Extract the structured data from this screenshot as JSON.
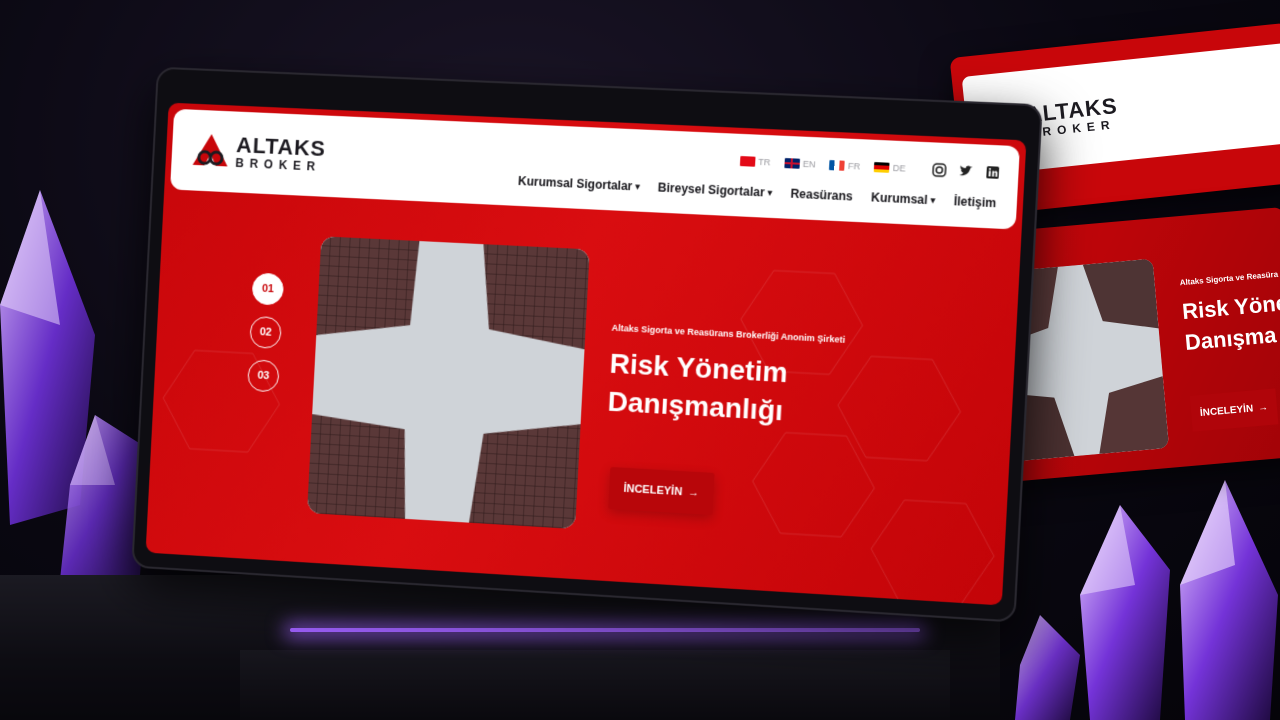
{
  "brand": {
    "name": "ALTAKS",
    "sub": "BROKER",
    "primary_color": "#c8060a",
    "accent_glow": "#a061ff"
  },
  "languages": [
    {
      "code": "TR",
      "flag": "turkey-flag-icon"
    },
    {
      "code": "EN",
      "flag": "uk-flag-icon"
    },
    {
      "code": "FR",
      "flag": "france-flag-icon"
    },
    {
      "code": "DE",
      "flag": "germany-flag-icon"
    }
  ],
  "socials": [
    "instagram-icon",
    "twitter-icon",
    "linkedin-icon"
  ],
  "nav": {
    "items": [
      {
        "label": "Kurumsal Sigortalar",
        "dropdown": true
      },
      {
        "label": "Bireysel Sigortalar",
        "dropdown": true
      },
      {
        "label": "Reasürans",
        "dropdown": false
      },
      {
        "label": "Kurumsal",
        "dropdown": true
      },
      {
        "label": "İletişim",
        "dropdown": false
      }
    ]
  },
  "slider": {
    "dots": [
      "01",
      "02",
      "03"
    ],
    "active": 0,
    "kicker": "Altaks Sigorta ve Reasürans Brokerliği Anonim Şirketi",
    "title": "Risk Yönetim Danışmanlığı",
    "cta_label": "İNCELEYİN",
    "cta_icon": "arrow-right-icon"
  },
  "side_panel": {
    "kicker": "Altaks Sigorta ve Reasüra",
    "title_line1": "Risk Yöne",
    "title_line2": "Danışma",
    "cta_label": "İNCELEYİN"
  }
}
